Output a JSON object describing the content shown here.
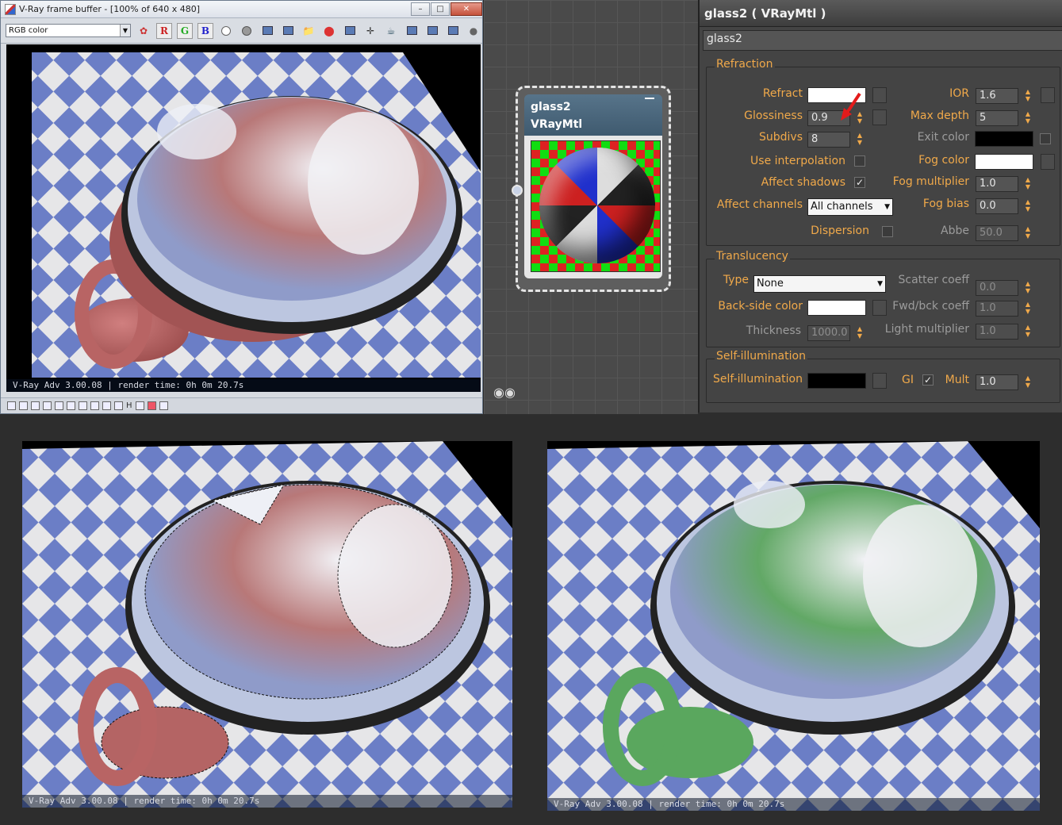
{
  "framebuffer": {
    "title": "V-Ray frame buffer - [100% of 640 x 480]",
    "channel_select": "RGB color",
    "toolbar": {
      "r": "R",
      "g": "G",
      "b": "B"
    },
    "caption": "V-Ray Adv 3.00.08 | render time:  0h  0m 20.7s",
    "bottom_buttons": [
      "H"
    ]
  },
  "node": {
    "name": "glass2",
    "type": "VRayMtl"
  },
  "material": {
    "title": "glass2  ( VRayMtl )",
    "name": "glass2",
    "refraction": {
      "group_label": "Refraction",
      "refract_label": "Refract",
      "ior_label": "IOR",
      "ior": "1.6",
      "glossiness_label": "Glossiness",
      "glossiness": "0.9",
      "max_depth_label": "Max depth",
      "max_depth": "5",
      "subdivs_label": "Subdivs",
      "subdivs": "8",
      "exit_color_label": "Exit color",
      "use_interp_label": "Use interpolation",
      "fog_color_label": "Fog color",
      "affect_shadows_label": "Affect shadows",
      "fog_mult_label": "Fog multiplier",
      "fog_mult": "1.0",
      "affect_channels_label": "Affect channels",
      "affect_channels": "All channels",
      "fog_bias_label": "Fog bias",
      "fog_bias": "0.0",
      "dispersion_label": "Dispersion",
      "abbe_label": "Abbe",
      "abbe": "50.0"
    },
    "translucency": {
      "group_label": "Translucency",
      "type_label": "Type",
      "type": "None",
      "scatter_label": "Scatter coeff",
      "scatter": "0.0",
      "backside_label": "Back-side color",
      "fwdbck_label": "Fwd/bck coeff",
      "fwdbck": "1.0",
      "thickness_label": "Thickness",
      "thickness": "1000.0",
      "light_mult_label": "Light multiplier",
      "light_mult": "1.0"
    },
    "self_illum": {
      "group_label": "Self-illumination",
      "label": "Self-illumination",
      "gi_label": "GI",
      "mult_label": "Mult",
      "mult": "1.0"
    },
    "colors": {
      "refract": "#ffffff",
      "exit": "#000000",
      "fog": "#ffffff",
      "backside": "#ffffff",
      "self_illum": "#000000"
    }
  },
  "renders": {
    "bottom_left_caption": "V-Ray Adv 3.00.08 | render time:  0h  0m 20.7s",
    "bottom_right_caption": "V-Ray Adv 3.00.08 | render time:  0h  0m 20.7s"
  },
  "accent_colors": {
    "label_orange": "#f0a94a",
    "cup_red": "#c46a6a",
    "cup_green": "#5aa75e",
    "checker_blue": "#6b7ec6"
  }
}
